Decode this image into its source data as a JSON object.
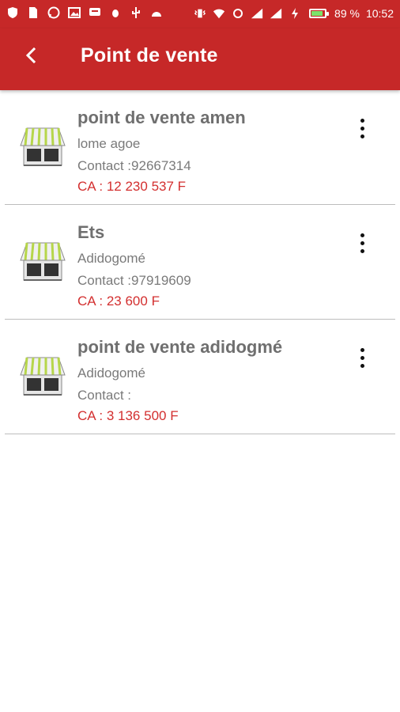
{
  "statusbar": {
    "battery": "89 %",
    "time": "10:52",
    "icons_left": [
      "shield-icon",
      "file-icon",
      "whatsapp-icon",
      "image-icon",
      "message-icon",
      "bug-icon",
      "usb-icon",
      "android-icon"
    ],
    "icons_right": [
      "vibrate-icon",
      "wifi-icon",
      "data-icon",
      "signal-icon",
      "signal-icon",
      "charging-icon",
      "battery-icon"
    ]
  },
  "header": {
    "title": "Point de vente",
    "back_icon": "back-arrow-icon"
  },
  "stores": [
    {
      "name": "point de vente amen",
      "address": "lome agoe",
      "contact": "Contact :92667314",
      "ca": "CA : 12 230 537   F"
    },
    {
      "name": "Ets",
      "address": " Adidogomé",
      "contact": "Contact :97919609",
      "ca": "CA : 23 600   F"
    },
    {
      "name": "point de vente adidogmé",
      "address": " Adidogomé",
      "contact": "Contact :",
      "ca": "CA : 3 136 500   F"
    }
  ],
  "colors": {
    "primary": "#c62828",
    "ca_text": "#d32f2f",
    "name_text": "#6f6f6f"
  }
}
